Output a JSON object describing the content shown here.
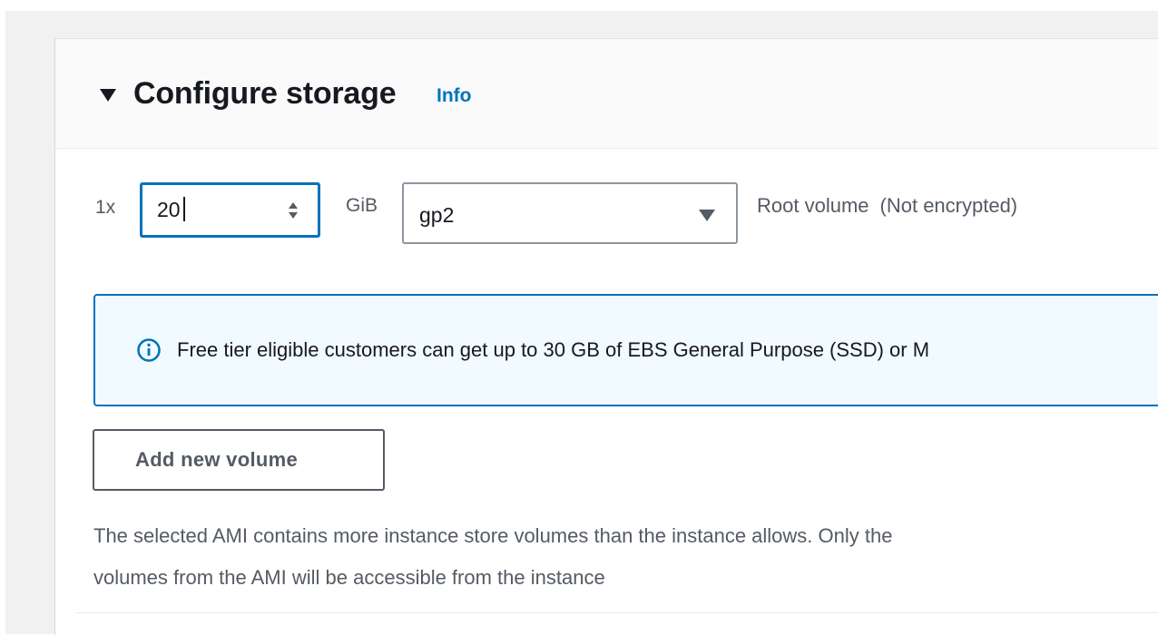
{
  "section": {
    "title": "Configure storage",
    "info_link": "Info"
  },
  "volume_row": {
    "quantity_label": "1x",
    "size_value": "20",
    "size_unit": "GiB",
    "volume_type": "gp2",
    "volume_name": "Root volume",
    "encryption_status": "(Not encrypted)"
  },
  "free_tier_alert": {
    "icon": "info-circle-icon",
    "text": "Free tier eligible customers can get up to 30 GB of EBS General Purpose (SSD) or M"
  },
  "add_volume_label": "Add new volume",
  "ami_warning": {
    "line1": "The selected AMI contains more instance store volumes than the instance allows. Only the",
    "line2": "volumes from the AMI will be accessible from the instance"
  },
  "colors": {
    "accent": "#0073bb",
    "alert_background": "#f1faff",
    "text_secondary": "#545b64"
  }
}
